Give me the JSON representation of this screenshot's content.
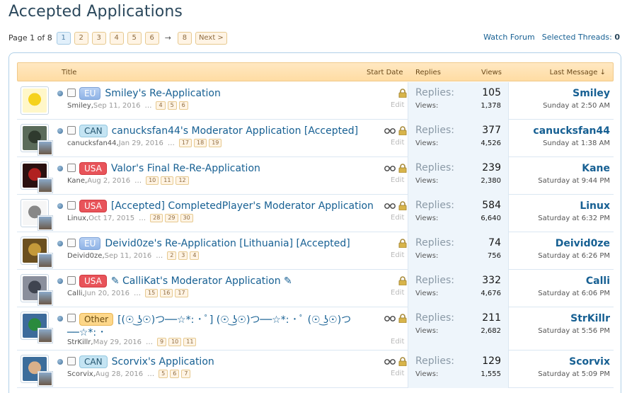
{
  "page_title": "Accepted Applications",
  "pagenav": {
    "label": "Page 1 of 8",
    "pages": [
      "1",
      "2",
      "3",
      "4",
      "5",
      "6"
    ],
    "arrow": "→",
    "last": "8",
    "next": "Next >"
  },
  "toplinks": {
    "watch": "Watch Forum",
    "selected_label": "Selected Threads:",
    "selected_count": "0"
  },
  "columns": {
    "title": "Title",
    "start_date": "Start Date",
    "replies": "Replies",
    "views": "Views",
    "last_message": "Last Message ↓"
  },
  "stat_labels": {
    "replies": "Replies:",
    "views": "Views:"
  },
  "edit_label": "Edit",
  "threads": [
    {
      "prefix": "EU",
      "title": "Smiley's Re-Application",
      "author": "Smiley",
      "date": "Sep 11, 2016",
      "pages": [
        "4",
        "5",
        "6"
      ],
      "replies": "105",
      "views": "1,378",
      "last_user": "Smiley",
      "last_time": "Sunday at 2:50 AM",
      "watched": false
    },
    {
      "prefix": "CAN",
      "title": "canucksfan44's Moderator Application [Accepted]",
      "author": "canucksfan44",
      "date": "Jan 29, 2016",
      "pages": [
        "17",
        "18",
        "19"
      ],
      "replies": "377",
      "views": "4,526",
      "last_user": "canucksfan44",
      "last_time": "Sunday at 1:38 AM",
      "watched": true
    },
    {
      "prefix": "USA",
      "title": "Valor's Final Re-Re-Application",
      "author": "Kane",
      "date": "Aug 2, 2016",
      "pages": [
        "10",
        "11",
        "12"
      ],
      "replies": "239",
      "views": "2,380",
      "last_user": "Kane",
      "last_time": "Saturday at 9:44 PM",
      "watched": true
    },
    {
      "prefix": "USA",
      "title": "[Accepted] CompletedPlayer's Moderator Application",
      "author": "Linux",
      "date": "Oct 17, 2015",
      "pages": [
        "28",
        "29",
        "30"
      ],
      "replies": "584",
      "views": "6,640",
      "last_user": "Linux",
      "last_time": "Saturday at 6:32 PM",
      "watched": true
    },
    {
      "prefix": "EU",
      "title": "Deivid0ze's Re-Application [Lithuania] [Accepted]",
      "author": "Deivid0ze",
      "date": "Sep 11, 2016",
      "pages": [
        "2",
        "3",
        "4"
      ],
      "replies": "74",
      "views": "756",
      "last_user": "Deivid0ze",
      "last_time": "Saturday at 6:26 PM",
      "watched": false
    },
    {
      "prefix": "USA",
      "title": "✎ CalliKat's Moderator Application ✎",
      "author": "Calli",
      "date": "Jun 20, 2016",
      "pages": [
        "15",
        "16",
        "17"
      ],
      "replies": "332",
      "views": "4,676",
      "last_user": "Calli",
      "last_time": "Saturday at 6:06 PM",
      "watched": false
    },
    {
      "prefix": "Other",
      "title": "[(☉ ͜ʖ☉)つ──☆*: ･ ﾟ] (☉ ͜ʖ☉)つ──☆*: ･ ﾟ (☉ ͜ʖ☉)つ",
      "title2": "──☆*: ･",
      "author": "StrKillr",
      "date": "May 29, 2016",
      "pages": [
        "9",
        "10",
        "11"
      ],
      "replies": "211",
      "views": "2,682",
      "last_user": "StrKillr",
      "last_time": "Saturday at 5:56 PM",
      "watched": true
    },
    {
      "prefix": "CAN",
      "title": "Scorvix's Application",
      "author": "Scorvix",
      "date": "Aug 28, 2016",
      "pages": [
        "5",
        "6",
        "7"
      ],
      "replies": "129",
      "views": "1,555",
      "last_user": "Scorvix",
      "last_time": "Saturday at 5:09 PM",
      "watched": true
    }
  ]
}
